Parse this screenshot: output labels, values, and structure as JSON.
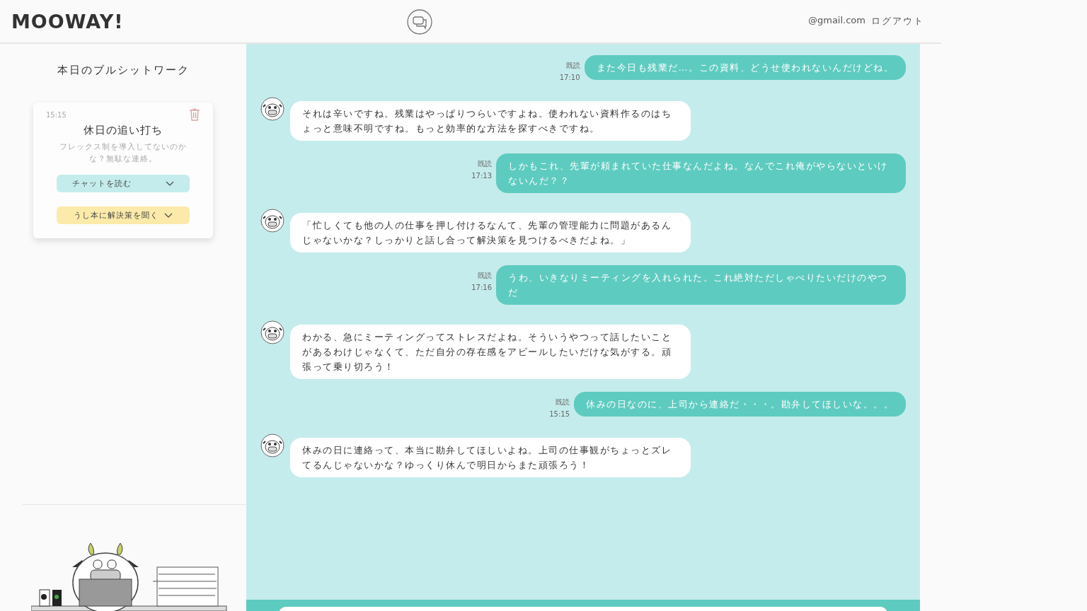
{
  "header": {
    "logo": "MOOWAY!",
    "email": "@gmail.com",
    "logout": "ログアウト"
  },
  "sidebar": {
    "title": "本日のブルシットワーク",
    "card": {
      "time": "15:15",
      "title": "休日の追い打ち",
      "summary": "フレックス制を導入してないのかな？無駄な連絡。",
      "read_chat": "チャットを読む",
      "ask_solution": "うし本に解決策を聞く"
    }
  },
  "messages": [
    {
      "kind": "user",
      "read": "既読",
      "time": "17:10",
      "text": "また今日も残業だ…。この資料、どうせ使われないんだけどね。"
    },
    {
      "kind": "bot",
      "text": "それは辛いですね。残業はやっぱりつらいですよね。使われない資料作るのはちょっと意味不明ですね。もっと効率的な方法を探すべきですね。"
    },
    {
      "kind": "user",
      "read": "既読",
      "time": "17:13",
      "text": "しかもこれ、先輩が頼まれていた仕事なんだよね。なんでこれ俺がやらないといけないんだ？？"
    },
    {
      "kind": "bot",
      "text": "「忙しくても他の人の仕事を押し付けるなんて、先輩の管理能力に問題があるんじゃないかな？しっかりと話し合って解決策を見つけるべきだよね。」"
    },
    {
      "kind": "user",
      "read": "既読",
      "time": "17:16",
      "text": "うわ、いきなりミーティングを入れられた。これ絶対ただしゃべりたいだけのやつだ"
    },
    {
      "kind": "bot",
      "text": "わかる、急にミーティングってストレスだよね。そういうやつって話したいことがあるわけじゃなくて、ただ自分の存在感をアピールしたいだけな気がする。頑張って乗り切ろう！"
    },
    {
      "kind": "user",
      "read": "既読",
      "time": "15:15",
      "text": "休みの日なのに、上司から連絡だ・・・。勘弁してほしいな。。。"
    },
    {
      "kind": "bot",
      "text": "休みの日に連絡って、本当に勘弁してほしいよね。上司の仕事観がちょっとズレてるんじゃないかな？ゆっくり休んで明日からまた頑張ろう！"
    }
  ]
}
